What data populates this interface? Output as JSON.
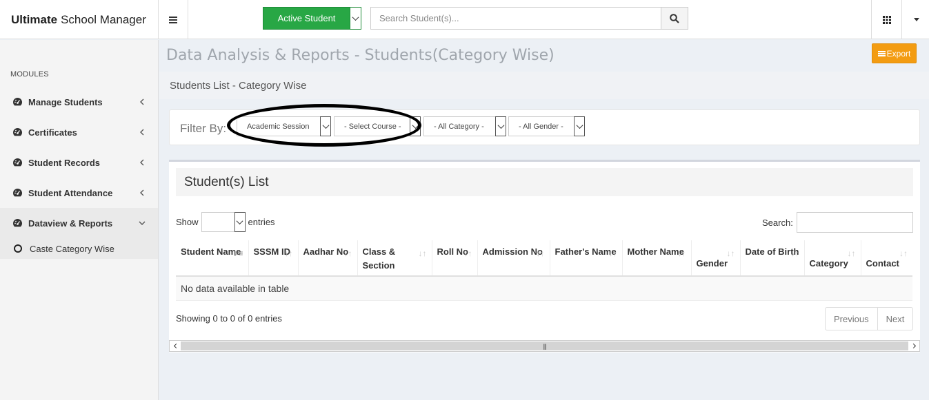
{
  "header": {
    "brand_bold": "Ultimate",
    "brand_rest": "School Manager",
    "active_student_label": "Active Student",
    "search_placeholder": "Search Student(s)..."
  },
  "sidebar": {
    "section_label": "MODULES",
    "items": [
      {
        "label": "Manage Students",
        "icon": "dashboard-icon",
        "expanded": false
      },
      {
        "label": "Certificates",
        "icon": "dashboard-icon",
        "expanded": false
      },
      {
        "label": "Student Records",
        "icon": "dashboard-icon",
        "expanded": false
      },
      {
        "label": "Student Attendance",
        "icon": "dashboard-icon",
        "expanded": false
      },
      {
        "label": "Dataview & Reports",
        "icon": "dashboard-icon",
        "expanded": true
      }
    ],
    "sub_items": [
      {
        "label": "Caste Category Wise"
      }
    ]
  },
  "page": {
    "title": "Data Analysis & Reports - Students(Category Wise)",
    "export_label": "Export",
    "subtitle": "Students List - Category Wise"
  },
  "filter": {
    "label": "Filter By:",
    "selects": [
      {
        "value": "Academic Session"
      },
      {
        "value": "- Select Course -"
      },
      {
        "value": "- All Category -"
      },
      {
        "value": "- All Gender -"
      }
    ]
  },
  "list": {
    "title": "Student(s) List",
    "show_label": "Show",
    "entries_label": "entries",
    "search_label": "Search:",
    "columns": [
      {
        "label": "Student Name"
      },
      {
        "label": "SSSM ID"
      },
      {
        "label": "Aadhar No"
      },
      {
        "label": "Class & Section"
      },
      {
        "label": "Roll No"
      },
      {
        "label": "Admission No"
      },
      {
        "label": "Father's Name"
      },
      {
        "label": "Mother Name"
      },
      {
        "label": "Gender"
      },
      {
        "label": "Date of Birth"
      },
      {
        "label": "Category"
      },
      {
        "label": "Contact"
      }
    ],
    "empty_message": "No data available in table",
    "info": "Showing 0 to 0 of 0 entries",
    "prev_label": "Previous",
    "next_label": "Next"
  },
  "colors": {
    "active_button": "#28a745",
    "export_button": "#f39c12"
  }
}
